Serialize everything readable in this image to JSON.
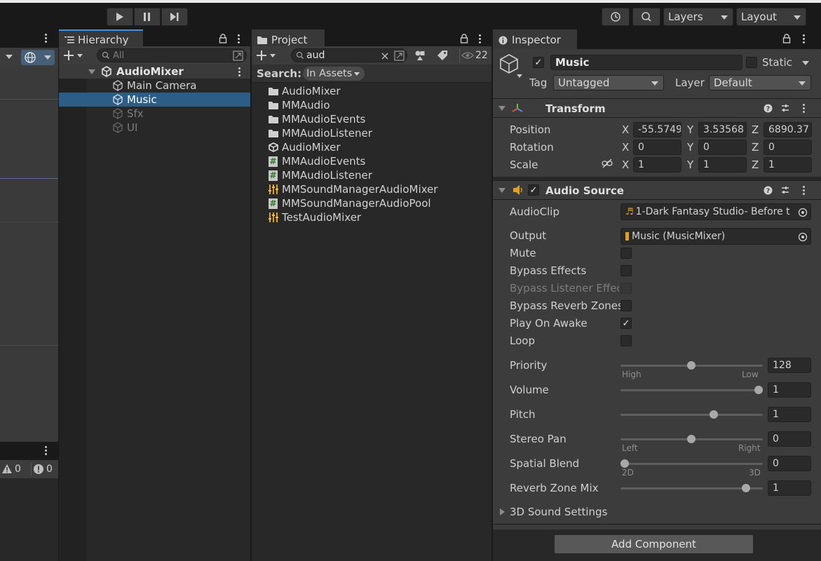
{
  "toolbar": {
    "play_icon": "play-icon",
    "layers_label": "Layers",
    "layout_label": "Layout"
  },
  "console_counts": {
    "warnings": "0",
    "errors": "0"
  },
  "hierarchy": {
    "tab": "Hierarchy",
    "search_placeholder": "All",
    "items": [
      {
        "label": "AudioMixer"
      },
      {
        "label": "Main Camera"
      },
      {
        "label": "Music"
      },
      {
        "label": "Sfx"
      },
      {
        "label": "UI"
      }
    ]
  },
  "project": {
    "tab": "Project",
    "search_value": "aud",
    "count": "22",
    "search_label": "Search:",
    "scope": "In Assets",
    "items": [
      {
        "label": "AudioMixer",
        "icon": "folder-icon"
      },
      {
        "label": "MMAudio",
        "icon": "folder-icon"
      },
      {
        "label": "MMAudioEvents",
        "icon": "folder-icon"
      },
      {
        "label": "MMAudioListener",
        "icon": "folder-icon"
      },
      {
        "label": "AudioMixer",
        "icon": "unity-icon"
      },
      {
        "label": "MMAudioEvents",
        "icon": "script-icon"
      },
      {
        "label": "MMAudioListener",
        "icon": "script-icon"
      },
      {
        "label": "MMSoundManagerAudioMixer",
        "icon": "mixer-icon"
      },
      {
        "label": "MMSoundManagerAudioPool",
        "icon": "script-icon"
      },
      {
        "label": "TestAudioMixer",
        "icon": "mixer-icon"
      }
    ]
  },
  "inspector": {
    "tab": "Inspector",
    "object_name": "Music",
    "static_label": "Static",
    "tag_label": "Tag",
    "tag_value": "Untagged",
    "layer_label": "Layer",
    "layer_value": "Default",
    "transform": {
      "title": "Transform",
      "position_label": "Position",
      "rotation_label": "Rotation",
      "scale_label": "Scale",
      "x": "X",
      "y": "Y",
      "z": "Z",
      "position": [
        "-55.5749",
        "3.53568",
        "6890.37"
      ],
      "rotation": [
        "0",
        "0",
        "0"
      ],
      "scale": [
        "1",
        "1",
        "1"
      ]
    },
    "audio_source": {
      "title": "Audio Source",
      "audioclip_label": "AudioClip",
      "audioclip_value": "1-Dark Fantasy Studio- Before t",
      "output_label": "Output",
      "output_value": "Music (MusicMixer)",
      "toggles": [
        {
          "label": "Mute",
          "checked": false
        },
        {
          "label": "Bypass Effects",
          "checked": false
        },
        {
          "label": "Bypass Listener Effec",
          "checked": false
        },
        {
          "label": "Bypass Reverb Zones",
          "checked": false
        },
        {
          "label": "Play On Awake",
          "checked": true
        },
        {
          "label": "Loop",
          "checked": false
        }
      ],
      "sliders": [
        {
          "label": "Priority",
          "value": "128",
          "fraction": 0.5,
          "low": "High",
          "high": "Low"
        },
        {
          "label": "Volume",
          "value": "1",
          "fraction": 1.0
        },
        {
          "label": "Pitch",
          "value": "1",
          "fraction": 0.65
        },
        {
          "label": "Stereo Pan",
          "value": "0",
          "fraction": 0.5,
          "low": "Left",
          "high": "Right"
        },
        {
          "label": "Spatial Blend",
          "value": "0",
          "fraction": 0.0,
          "low": "2D",
          "high": "3D"
        },
        {
          "label": "Reverb Zone Mix",
          "value": "1",
          "fraction": 0.9
        }
      ],
      "sound_settings": "3D Sound Settings"
    },
    "add_component": "Add Component"
  },
  "colors": {
    "accent": "#4a90d9",
    "selection": "#2c5d87",
    "bg": "#282828"
  }
}
